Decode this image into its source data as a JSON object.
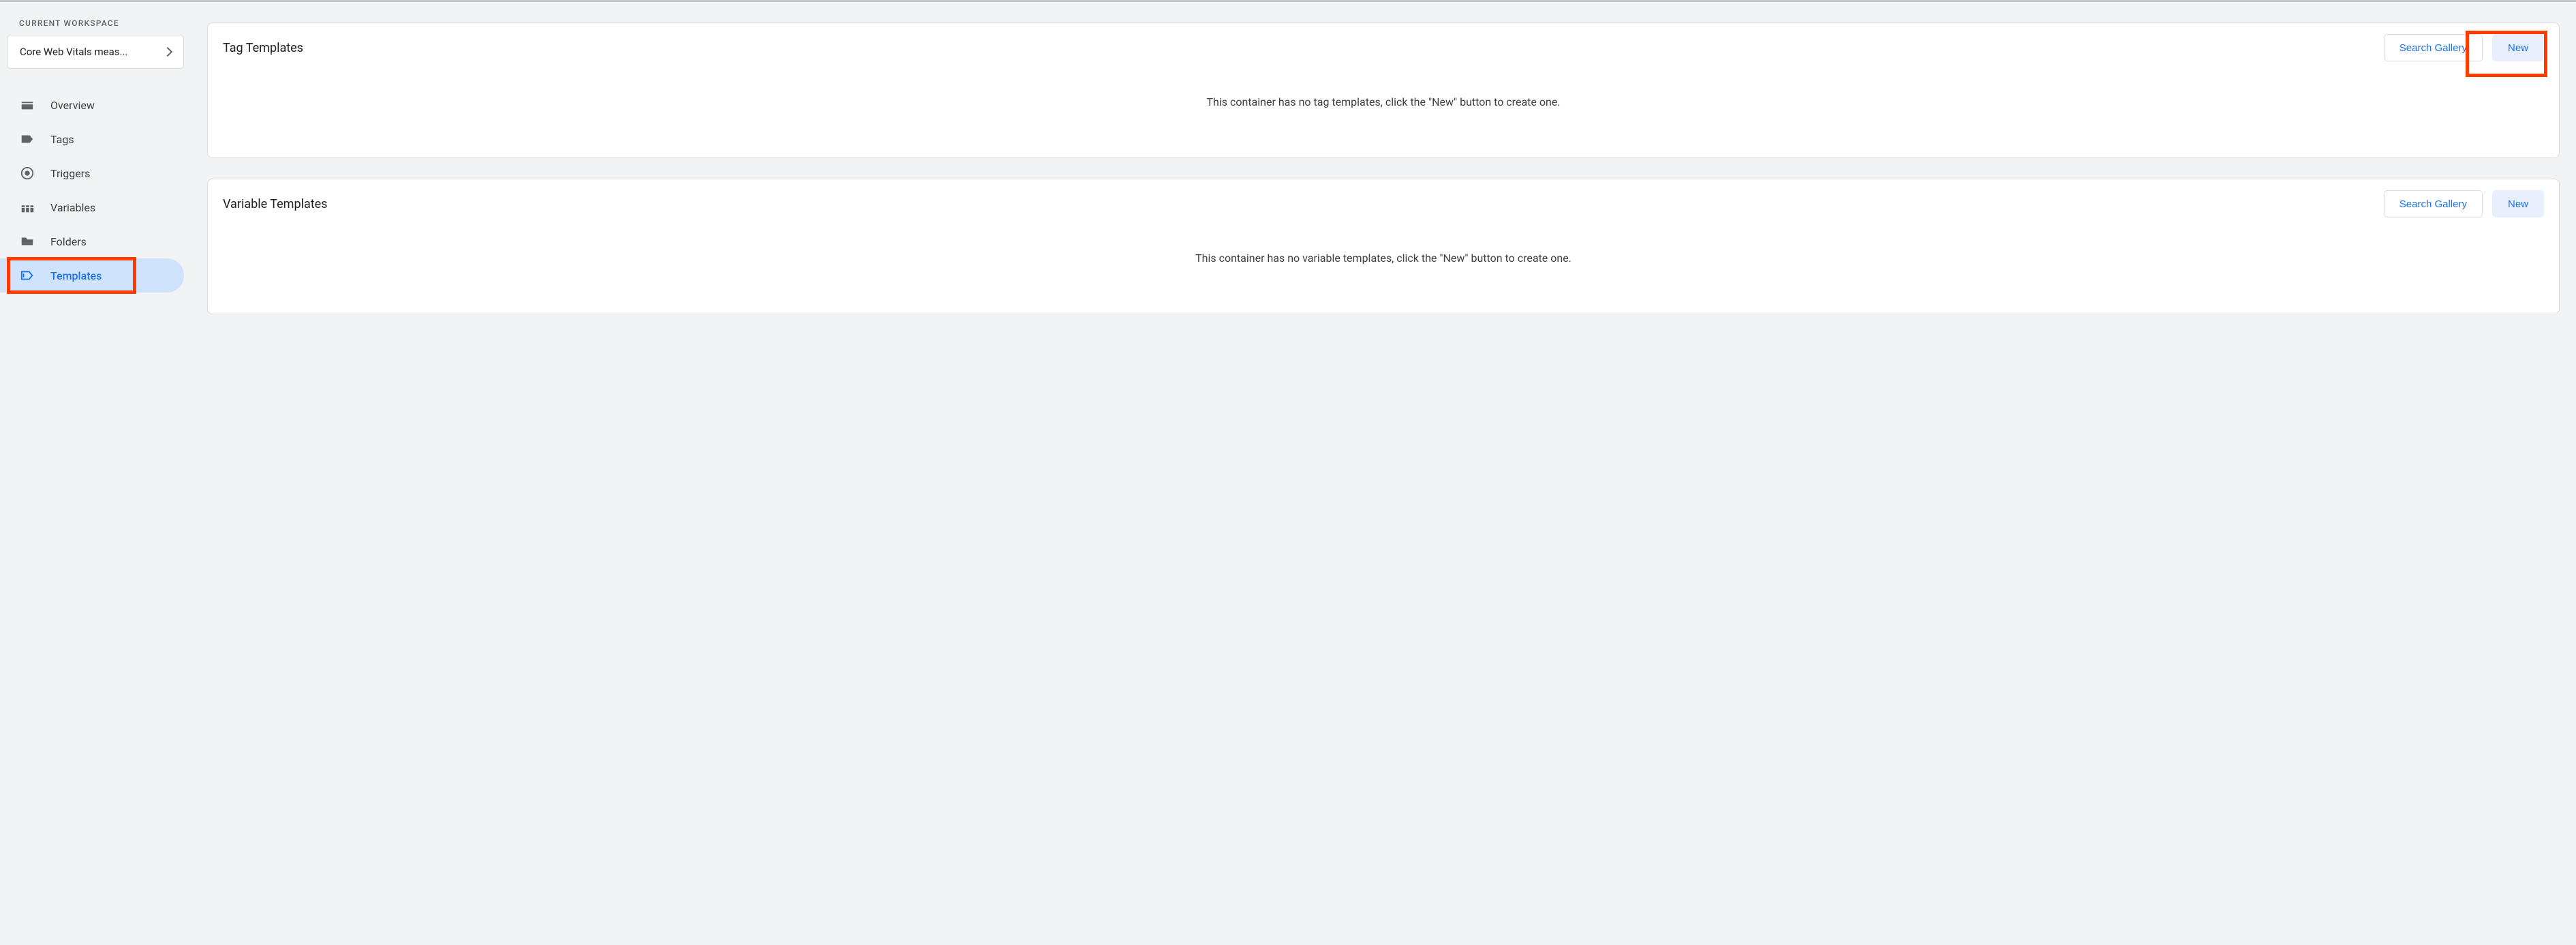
{
  "sidebar": {
    "workspace_label": "CURRENT WORKSPACE",
    "workspace_name": "Core Web Vitals meas...",
    "items": [
      {
        "label": "Overview"
      },
      {
        "label": "Tags"
      },
      {
        "label": "Triggers"
      },
      {
        "label": "Variables"
      },
      {
        "label": "Folders"
      },
      {
        "label": "Templates"
      }
    ]
  },
  "cards": {
    "tag_templates": {
      "title": "Tag Templates",
      "search_gallery": "Search Gallery",
      "new_label": "New",
      "empty": "This container has no tag templates, click the \"New\" button to create one."
    },
    "variable_templates": {
      "title": "Variable Templates",
      "search_gallery": "Search Gallery",
      "new_label": "New",
      "empty": "This container has no variable templates, click the \"New\" button to create one."
    }
  }
}
